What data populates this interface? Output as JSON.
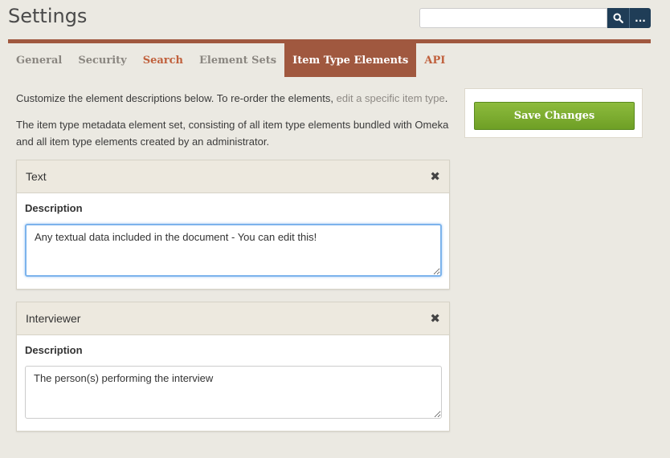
{
  "header": {
    "title": "Settings",
    "search": {
      "value": "",
      "placeholder": ""
    },
    "search_button_icon": "search-icon",
    "more_button_label": "..."
  },
  "tabs": [
    {
      "label": "General",
      "state": "inactive"
    },
    {
      "label": "Security",
      "state": "inactive"
    },
    {
      "label": "Search",
      "state": "accent"
    },
    {
      "label": "Element Sets",
      "state": "inactive"
    },
    {
      "label": "Item Type Elements",
      "state": "active"
    },
    {
      "label": "API",
      "state": "accent"
    }
  ],
  "intro": {
    "line1_text": "Customize the element descriptions below. To re-order the elements, ",
    "line1_link": "edit a specific item type",
    "line1_end": ".",
    "line2_text": "The item type metadata element set, consisting of all item type elements bundled with Omeka and all item type elements created by an administrator."
  },
  "elements": [
    {
      "name": "Text",
      "description_label": "Description",
      "description_value": "Any textual data included in the document - You can edit this!",
      "focused": true
    },
    {
      "name": "Interviewer",
      "description_label": "Description",
      "description_value": "The person(s) performing the interview",
      "focused": false
    }
  ],
  "sidebar": {
    "save_label": "Save Changes"
  },
  "colors": {
    "brand": "#a0583f",
    "accent_tab": "#c0603c",
    "save_button": "#7aab2e",
    "search_button": "#1f3d57",
    "background": "#ebe9e2"
  }
}
